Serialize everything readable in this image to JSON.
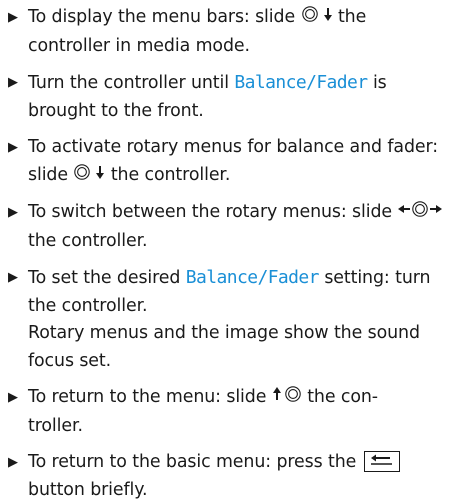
{
  "steps": [
    {
      "parts": [
        "To display the menu bars: slide",
        "the controller in media mode."
      ]
    },
    {
      "parts": [
        "Turn the controller until",
        "Balance/Fader",
        "is brought to the front."
      ]
    },
    {
      "parts": [
        "To activate rotary menus for balance and fader: slide",
        "the controller."
      ]
    },
    {
      "parts": [
        "To switch between the rotary menus: slide",
        "the controller."
      ]
    },
    {
      "parts": [
        "To set the desired",
        "Balance/Fader",
        "setting: turn the controller.",
        "Rotary menus and the image show the sound focus set."
      ]
    },
    {
      "parts": [
        "To return to the menu: slide",
        "the con-",
        "troller."
      ]
    },
    {
      "parts": [
        "To return to the basic menu: press the",
        "button briefly."
      ]
    }
  ],
  "icons": {
    "bullet": "triangle-bullet-icon",
    "controller": "controller-icon",
    "arrow_down": "arrow-down-icon",
    "arrow_up": "arrow-up-icon",
    "arrow_left": "arrow-left-icon",
    "arrow_right": "arrow-right-icon",
    "back_button": "back-button-icon"
  },
  "colors": {
    "highlight": "#1a8fd6",
    "text": "#1a1a1a"
  }
}
